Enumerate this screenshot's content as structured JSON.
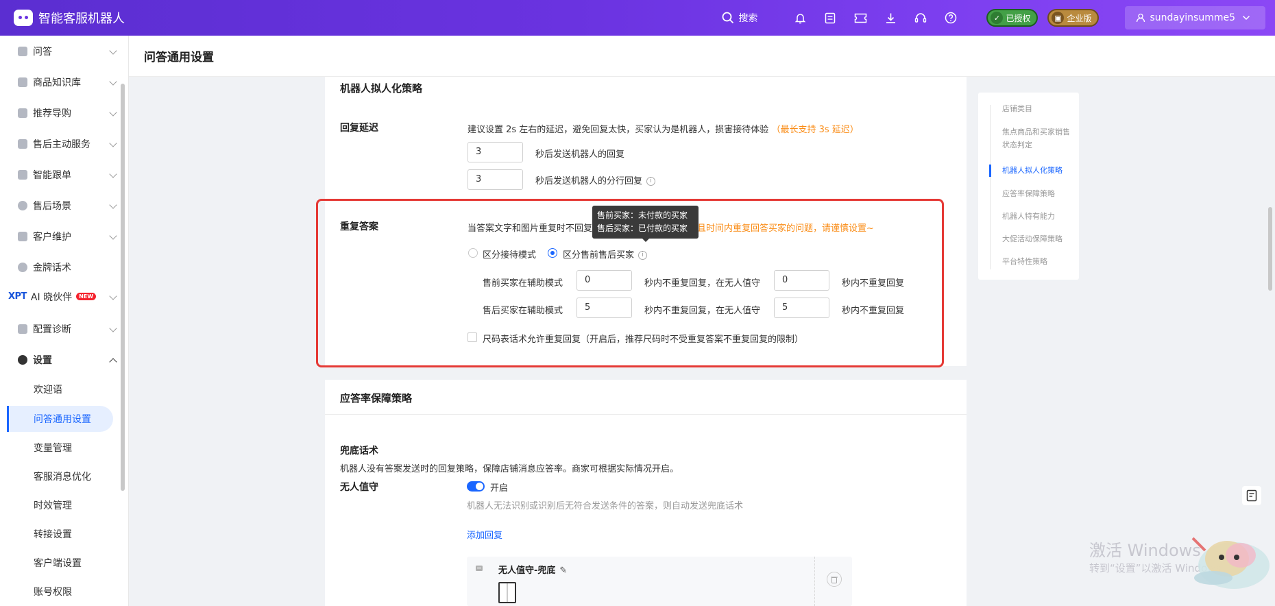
{
  "app": {
    "title": "智能客服机器人"
  },
  "topbar": {
    "search_label": "搜索",
    "authorized_badge": "已授权",
    "enterprise_badge": "企业版",
    "username": "sundayinsumme5"
  },
  "sidebar": {
    "items": [
      {
        "label": "问答"
      },
      {
        "label": "商品知识库"
      },
      {
        "label": "推荐导购"
      },
      {
        "label": "售后主动服务"
      },
      {
        "label": "智能跟单"
      },
      {
        "label": "售后场景"
      },
      {
        "label": "客户维护"
      },
      {
        "label": "金牌话术"
      },
      {
        "label": "AI 晓伙伴",
        "prefix": "XPT",
        "badge": "NEW"
      },
      {
        "label": "配置诊断"
      },
      {
        "label": "设置"
      }
    ],
    "sub_items": [
      {
        "label": "欢迎语"
      },
      {
        "label": "问答通用设置",
        "active": true
      },
      {
        "label": "变量管理"
      },
      {
        "label": "客服消息优化"
      },
      {
        "label": "时效管理"
      },
      {
        "label": "转接设置"
      },
      {
        "label": "客户端设置"
      },
      {
        "label": "账号权限"
      }
    ]
  },
  "page": {
    "title": "问答通用设置"
  },
  "robot_strategy": {
    "title": "机器人拟人化策略",
    "reply_delay": {
      "label": "回复延迟",
      "hint": "建议设置 2s 左右的延迟，避免回复太快，买家认为是机器人，损害接待体验",
      "hint_highlight": "（最长支持 3s 延迟）",
      "delay_value": "3",
      "delay_text": "秒后发送机器人的回复",
      "split_value": "3",
      "split_text": "秒后发送机器人的分行回复"
    },
    "repeat_answer": {
      "label": "重复答案",
      "desc_prefix": "当答案文字和图片重复时不回复",
      "desc_warning": "且时间内重复回答买家的问题，请谨慎设置~",
      "mode_option_1": "区分接待模式",
      "mode_option_2": "区分售前售后买家",
      "selected_mode": "区分售前售后买家",
      "presale": {
        "label": "售前买家在辅助模式",
        "assist_value": "0",
        "mid_text": "秒内不重复回复，在无人值守",
        "unattended_value": "0",
        "end_text": "秒内不重复回复"
      },
      "aftersale": {
        "label": "售后买家在辅助模式",
        "assist_value": "5",
        "mid_text": "秒内不重复回复，在无人值守",
        "unattended_value": "5",
        "end_text": "秒内不重复回复"
      },
      "size_checkbox_text": "尺码表话术允许重复回复（开启后，推荐尺码时不受重复答案不重复回复的限制）",
      "size_checkbox_checked": false
    },
    "tooltip": {
      "line1": "售前买家：未付款的买家",
      "line2": "售后买家：已付款的买家"
    }
  },
  "response_rate": {
    "title": "应答率保障策略",
    "fallback_title": "兜底话术",
    "fallback_desc": "机器人没有答案发送时的回复策略，保障店铺消息应答率。商家可根据实际情况开启。",
    "unattended_label": "无人值守",
    "toggle_text": "开启",
    "toggle_on": true,
    "unattended_desc": "机器人无法识别或识别后无符合发送条件的答案，则自动发送兜底话术",
    "add_reply": "添加回复",
    "reply_card_title": "无人值守-兜底"
  },
  "anchors": [
    {
      "label": "店铺类目"
    },
    {
      "label": "焦点商品和买家销售状态判定"
    },
    {
      "label": "机器人拟人化策略",
      "active": true
    },
    {
      "label": "应答率保障策略"
    },
    {
      "label": "机器人特有能力"
    },
    {
      "label": "大促活动保障策略"
    },
    {
      "label": "平台特性策略"
    }
  ],
  "watermark": {
    "line1": "激活 Windows",
    "line2": "转到“设置”以激活 Windows。"
  },
  "colors": {
    "topbar_start": "#5b2ed1",
    "topbar_end": "#8b47f5",
    "accent": "#1a66ff",
    "warning": "#fa8c16",
    "highlight_box": "#e53935"
  }
}
